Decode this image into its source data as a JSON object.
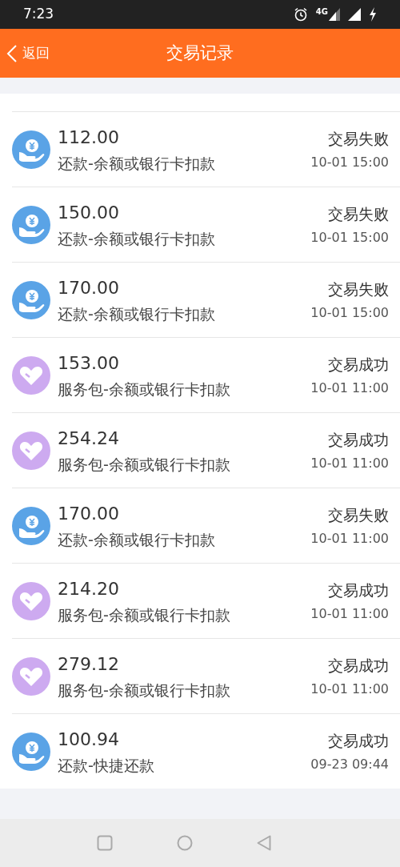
{
  "status_bar": {
    "time": "7:23",
    "network": "4G"
  },
  "header": {
    "back": "返回",
    "title": "交易记录"
  },
  "rows": [
    {
      "kind": "repay",
      "amount": "112.00",
      "description": "还款-余额或银行卡扣款",
      "status": "交易失败",
      "time": "10-01 15:00"
    },
    {
      "kind": "repay",
      "amount": "150.00",
      "description": "还款-余额或银行卡扣款",
      "status": "交易失败",
      "time": "10-01 15:00"
    },
    {
      "kind": "repay",
      "amount": "170.00",
      "description": "还款-余额或银行卡扣款",
      "status": "交易失败",
      "time": "10-01 15:00"
    },
    {
      "kind": "service",
      "amount": "153.00",
      "description": "服务包-余额或银行卡扣款",
      "status": "交易成功",
      "time": "10-01 11:00"
    },
    {
      "kind": "service",
      "amount": "254.24",
      "description": "服务包-余额或银行卡扣款",
      "status": "交易成功",
      "time": "10-01 11:00"
    },
    {
      "kind": "repay",
      "amount": "170.00",
      "description": "还款-余额或银行卡扣款",
      "status": "交易失败",
      "time": "10-01 11:00"
    },
    {
      "kind": "service",
      "amount": "214.20",
      "description": "服务包-余额或银行卡扣款",
      "status": "交易成功",
      "time": "10-01 11:00"
    },
    {
      "kind": "service",
      "amount": "279.12",
      "description": "服务包-余额或银行卡扣款",
      "status": "交易成功",
      "time": "10-01 11:00"
    },
    {
      "kind": "repay",
      "amount": "100.94",
      "description": "还款-快捷还款",
      "status": "交易成功",
      "time": "09-23 09:44"
    }
  ]
}
